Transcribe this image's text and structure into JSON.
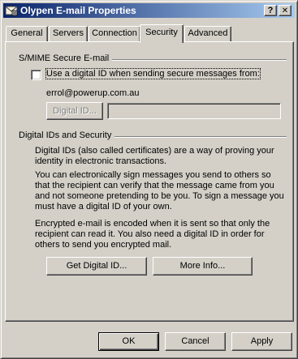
{
  "window": {
    "title": "Olypen E-mail Properties",
    "help_glyph": "?",
    "close_glyph": "✕"
  },
  "tabs": [
    {
      "label": "General",
      "active": false
    },
    {
      "label": "Servers",
      "active": false
    },
    {
      "label": "Connection",
      "active": false
    },
    {
      "label": "Security",
      "active": true
    },
    {
      "label": "Advanced",
      "active": false
    }
  ],
  "smime": {
    "group_title": "S/MIME Secure E-mail",
    "checkbox_label": "Use a digital ID when sending secure messages from:",
    "checkbox_checked": false,
    "email_address": "errol@powerup.com.au",
    "digital_id_button": "Digital ID...",
    "digital_id_field_value": ""
  },
  "ids": {
    "group_title": "Digital IDs and Security",
    "para1": "Digital IDs (also called certificates) are a way of proving your identity in electronic transactions.",
    "para2": "You can electronically sign messages you send to others so that the recipient can verify that the message came from you and not someone pretending to be you. To sign a message you must have a digital ID of your own.",
    "para3": "Encrypted e-mail is encoded when it is sent so that only the recipient can read it. You also need a digital ID in order for others to send you encrypted mail.",
    "get_id_button": "Get Digital ID...",
    "more_info_button": "More Info..."
  },
  "footer": {
    "ok": "OK",
    "cancel": "Cancel",
    "apply": "Apply"
  }
}
